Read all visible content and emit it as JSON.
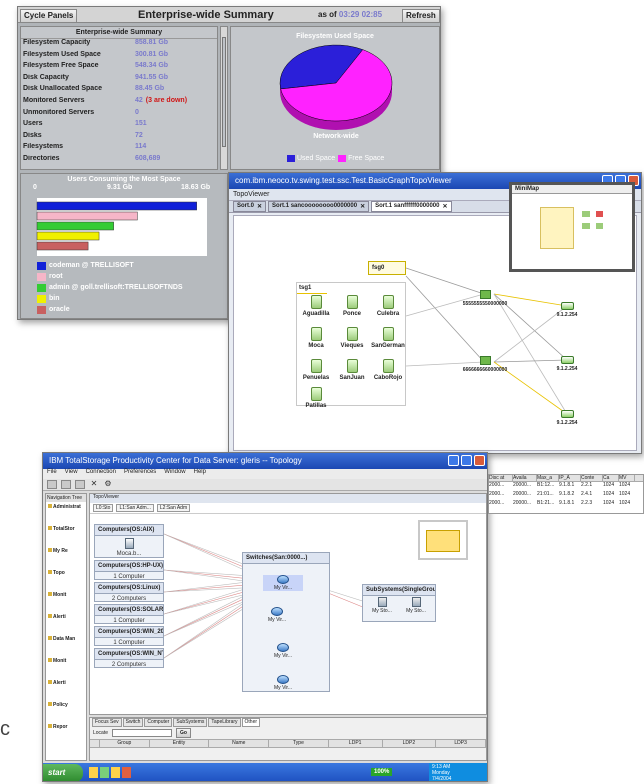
{
  "summary": {
    "cycle_label": "Cycle Panels",
    "title": "Enterprise-wide Summary",
    "as_of_prefix": "as of",
    "as_of_time": "03:29 02:85",
    "refresh_label": "Refresh",
    "table_title": "Enterprise-wide Summary",
    "rows": [
      {
        "label": "Filesystem Capacity",
        "value": "858.81 Gb"
      },
      {
        "label": "Filesystem Used Space",
        "value": "300.81 Gb"
      },
      {
        "label": "Filesystem Free Space",
        "value": "548.34 Gb"
      },
      {
        "label": "Disk Capacity",
        "value": "941.55 Gb"
      },
      {
        "label": "Disk Unallocated Space",
        "value": "88.45 Gb"
      },
      {
        "label": "Monitored Servers",
        "value": "42",
        "extra": "(3 are down)"
      },
      {
        "label": "Unmonitored Servers",
        "value": "0"
      },
      {
        "label": "Users",
        "value": "151"
      },
      {
        "label": "Disks",
        "value": "72"
      },
      {
        "label": "Filesystems",
        "value": "114"
      },
      {
        "label": "Directories",
        "value": "608,689"
      }
    ],
    "pie_title": "Filesystem Used Space",
    "pie_caption": "Network-wide",
    "pie_legend": [
      "Used Space",
      "Free Space"
    ],
    "colors": {
      "used": "#2b1fd9",
      "free": "#ff22ff",
      "value_text": "#7a7acc",
      "alert": "#d01515"
    },
    "users_title": "Users Consuming the Most Space",
    "users_axis": [
      "0",
      "9.31 Gb",
      "18.63 Gb"
    ],
    "users": [
      {
        "name": "codeman @ TRELLISOFT",
        "color": "#1020d8"
      },
      {
        "name": "root",
        "color": "#f6b6c8"
      },
      {
        "name": "admin @ goll.trellisoft:TRELLISOFTNDS",
        "color": "#33cc33"
      },
      {
        "name": "bin",
        "color": "#f0f000"
      },
      {
        "name": "oracle",
        "color": "#c86060"
      }
    ]
  },
  "chart_data": [
    {
      "type": "pie",
      "title": "Filesystem Used Space",
      "labels": [
        "Used Space",
        "Free Space"
      ],
      "values": [
        300.81,
        548.34
      ],
      "caption": "Network-wide"
    },
    {
      "type": "bar",
      "title": "Users Consuming the Most Space",
      "categories": [
        "codeman @ TRELLISOFT",
        "root",
        "admin @ goll.trellisoft:TRELLISOFTNDS",
        "bin",
        "oracle"
      ],
      "values": [
        17.5,
        11.0,
        8.4,
        6.8,
        5.6
      ],
      "xlim": [
        0,
        18.63
      ],
      "unit": "Gb"
    }
  ],
  "topo": {
    "title": "com.ibm.neoco.tv.swing.test.ssc.Test.BasicGraphTopoViewer",
    "inner_title": "TopoViewer",
    "tabs": [
      "Sort.0",
      "Sort.1 sancoooooooo0000000",
      "Sort.1 sanffffff0000000"
    ],
    "minimap_title": "MiniMap",
    "group_label": "tsg1",
    "group_small": "fsg0",
    "nodes": [
      "Aguadilla",
      "Ponce",
      "Culebra",
      "Moca",
      "Vieques",
      "SanGerman",
      "Penuelas",
      "SanJuan",
      "CaboRojo",
      "Patillas"
    ],
    "switches": [
      "5555555550000000",
      "6666666660000000"
    ],
    "targets": [
      "9.1.2.254",
      "9.1.2.254",
      "9.1.2.254"
    ]
  },
  "tpc": {
    "title": "IBM TotalStorage Productivity Center for Data Server: gleris -- Topology",
    "menu": [
      "File",
      "View",
      "Connection",
      "Preferences",
      "Window",
      "Help"
    ],
    "nav_title": "Navigation Tree",
    "nav_items": [
      "Administrat",
      "TotalStor",
      "My Re",
      "Topo",
      "Monit",
      "Alerti",
      "Data Man",
      "Monit",
      "Alerti",
      "Policy",
      "Repor"
    ],
    "viewer_tab": "TopoViewer",
    "breadcrumb": [
      "L0:Sto",
      "L1:San Adm...",
      "L2:San Adm"
    ],
    "groups": [
      {
        "title": "Computers(OS:AIX)",
        "sub": "Moca.b..."
      },
      {
        "title": "Computers(OS:HP-UX)",
        "sub": "1 Computer"
      },
      {
        "title": "Computers(OS:Linux)",
        "sub": "2 Computers"
      },
      {
        "title": "Computers(OS:SOLARIS)",
        "sub": "1 Computer"
      },
      {
        "title": "Computers(OS:WIN_2000)",
        "sub": "1 Computer"
      },
      {
        "title": "Computers(OS:WIN_NT)",
        "sub": "2 Computers"
      }
    ],
    "switch_group": "Switches(San:0000...)",
    "switch_items": [
      "My Vir...",
      "My Vir...",
      "My Vir...",
      "My Vir..."
    ],
    "subsys_group": "SubSystems(SingleGroup)",
    "subsys_items": [
      "My Sto...",
      "My Sto..."
    ],
    "bottom_tabs": [
      "Focus Sev",
      "Switch",
      "Computer",
      "SubSystems",
      "TapeLibrary",
      "Other"
    ],
    "locate_label": "Locate",
    "go_label": "Go",
    "columns": [
      "Group",
      "Entity",
      "Name",
      "Type",
      "LDP1",
      "LDP2",
      "LDP3"
    ],
    "right_cols": [
      "Disc at",
      "Availa",
      "Max_a",
      "IP_A",
      "Conte",
      "Ca",
      "MV"
    ],
    "right_rows": [
      [
        "2000...",
        "20000...",
        "B1:12...",
        "9.1.8.1",
        "2.2.1",
        "1024",
        "1024"
      ],
      [
        "2000...",
        "20000...",
        "21:01...",
        "9.1.8.2",
        "2.4.1",
        "1024",
        "1024"
      ],
      [
        "2000...",
        "20000...",
        "B1:21...",
        "9.1.8.1",
        "2.2.3",
        "1024",
        "1024"
      ]
    ],
    "start_label": "start",
    "zoom": "100%",
    "clock": "9:13 AM",
    "day": "Monday",
    "date": "7/4/2004"
  },
  "edge_char": "c"
}
